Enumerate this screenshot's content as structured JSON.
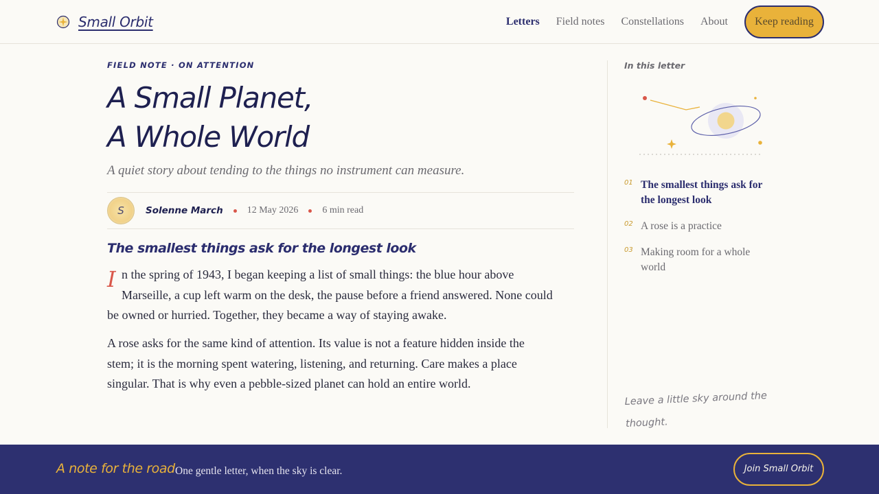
{
  "brand": {
    "name": "Small Orbit",
    "icon": "orbit-star-icon"
  },
  "nav": {
    "links": [
      {
        "label": "Letters",
        "active": true
      },
      {
        "label": "Field notes",
        "active": false
      },
      {
        "label": "Constellations",
        "active": false
      },
      {
        "label": "About",
        "active": false
      }
    ],
    "cta": "Keep reading"
  },
  "article": {
    "kicker": "FIELD NOTE · ON ATTENTION",
    "title_line1": "A Small Planet,",
    "title_line2": "A Whole World",
    "dek": "A quiet story about tending to the things no instrument can measure.",
    "author_initial": "S",
    "author": "Solenne March",
    "date": "12 May 2026",
    "read_time": "6 min read",
    "section_heading": "The smallest things ask for the longest look",
    "dropcap": "I",
    "p1_rest": "n the spring of 1943, I began keeping a list of small things: the blue hour above Marseille, a cup left warm on the desk, the pause before a friend answered. None could be owned or hurried. Together, they became a way of staying awake.",
    "p2": "A rose asks for the same kind of attention. Its value is not a feature hidden inside the stem; it is the morning spent watering, listening, and returning. Care makes a place singular. That is why even a pebble-sized planet can hold an entire world."
  },
  "sidebar": {
    "heading": "In this letter",
    "toc": [
      {
        "num": "01",
        "label": "The smallest things ask for the longest look",
        "current": true
      },
      {
        "num": "02",
        "label": "A rose is a practice",
        "current": false
      },
      {
        "num": "03",
        "label": "Making room for a whole world",
        "current": false
      }
    ],
    "note": "Leave a little sky around the thought."
  },
  "footer": {
    "title": "A note for the road",
    "text": "One gentle letter, when the sky is clear.",
    "cta": "Join Small Orbit"
  },
  "colors": {
    "navy": "#2d3070",
    "gold": "#e9b23a",
    "coral": "#d9574a",
    "paper": "#fbfaf6"
  }
}
